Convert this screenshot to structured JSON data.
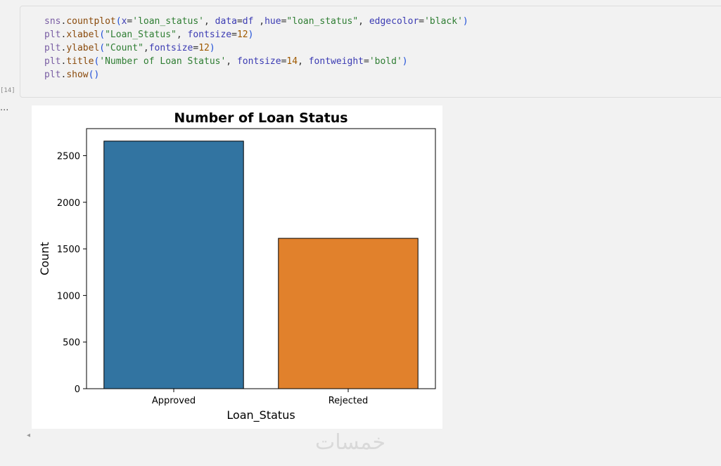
{
  "cell": {
    "execution_count": "[14]",
    "output_prompt": "...",
    "code_lines": [
      [
        [
          "sns",
          "tk-mod"
        ],
        [
          ".",
          "tk-pl"
        ],
        [
          "countplot",
          "tk-fn"
        ],
        [
          "(",
          "tk-p"
        ],
        [
          "x",
          "tk-arg"
        ],
        [
          "=",
          "tk-pl"
        ],
        [
          "'loan_status'",
          "tk-str"
        ],
        [
          ", ",
          "tk-pl"
        ],
        [
          "data",
          "tk-arg"
        ],
        [
          "=",
          "tk-pl"
        ],
        [
          "df",
          "tk-arg"
        ],
        [
          " ,",
          "tk-pl"
        ],
        [
          "hue",
          "tk-arg"
        ],
        [
          "=",
          "tk-pl"
        ],
        [
          "\"loan_status\"",
          "tk-str"
        ],
        [
          ", ",
          "tk-pl"
        ],
        [
          "edgecolor",
          "tk-arg"
        ],
        [
          "=",
          "tk-pl"
        ],
        [
          "'black'",
          "tk-str"
        ],
        [
          ")",
          "tk-p"
        ]
      ],
      [
        [
          "plt",
          "tk-mod"
        ],
        [
          ".",
          "tk-pl"
        ],
        [
          "xlabel",
          "tk-fn"
        ],
        [
          "(",
          "tk-p"
        ],
        [
          "\"Loan_Status\"",
          "tk-str"
        ],
        [
          ", ",
          "tk-pl"
        ],
        [
          "fontsize",
          "tk-arg"
        ],
        [
          "=",
          "tk-pl"
        ],
        [
          "12",
          "tk-num"
        ],
        [
          ")",
          "tk-p"
        ]
      ],
      [
        [
          "plt",
          "tk-mod"
        ],
        [
          ".",
          "tk-pl"
        ],
        [
          "ylabel",
          "tk-fn"
        ],
        [
          "(",
          "tk-p"
        ],
        [
          "\"Count\"",
          "tk-str"
        ],
        [
          ",",
          "tk-pl"
        ],
        [
          "fontsize",
          "tk-arg"
        ],
        [
          "=",
          "tk-pl"
        ],
        [
          "12",
          "tk-num"
        ],
        [
          ")",
          "tk-p"
        ]
      ],
      [
        [
          "plt",
          "tk-mod"
        ],
        [
          ".",
          "tk-pl"
        ],
        [
          "title",
          "tk-fn"
        ],
        [
          "(",
          "tk-p"
        ],
        [
          "'Number of Loan Status'",
          "tk-str"
        ],
        [
          ", ",
          "tk-pl"
        ],
        [
          "fontsize",
          "tk-arg"
        ],
        [
          "=",
          "tk-pl"
        ],
        [
          "14",
          "tk-num"
        ],
        [
          ", ",
          "tk-pl"
        ],
        [
          "fontweight",
          "tk-arg"
        ],
        [
          "=",
          "tk-pl"
        ],
        [
          "'bold'",
          "tk-str"
        ],
        [
          ")",
          "tk-p"
        ]
      ],
      [
        [
          "plt",
          "tk-mod"
        ],
        [
          ".",
          "tk-pl"
        ],
        [
          "show",
          "tk-fn"
        ],
        [
          "()",
          "tk-p"
        ]
      ]
    ]
  },
  "chart_data": {
    "type": "bar",
    "title": "Number of Loan Status",
    "xlabel": "Loan_Status",
    "ylabel": "Count",
    "categories": [
      "Approved",
      "Rejected"
    ],
    "values": [
      2656,
      1613
    ],
    "colors": [
      "#3274a1",
      "#e1812c"
    ],
    "edgecolor": "#000000",
    "ylim": [
      0,
      2790
    ],
    "yticks": [
      0,
      500,
      1000,
      1500,
      2000,
      2500
    ],
    "grid": false,
    "legend": "none"
  },
  "watermark": {
    "text": "خمسات"
  },
  "icons": {
    "scroll_left": "◂"
  }
}
